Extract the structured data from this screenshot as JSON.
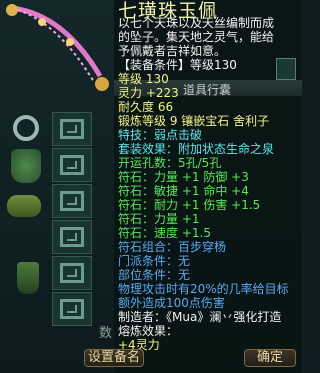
{
  "panel": {
    "title": "道具行囊"
  },
  "tooltip": {
    "name": "七璜珠玉佩",
    "desc_lines": [
      "以七个天珠以及天丝编制而成",
      "的坠子。集天地之灵气，能给",
      "予佩戴者吉祥如意。"
    ],
    "requirement": "【装备条件】等级130",
    "stats": [
      "等级 130",
      "灵力 +223",
      "耐久度 66"
    ],
    "forge": "锻炼等级 9   镶嵌宝石 舍利子",
    "special": "特技：弱点击破",
    "set_effect": "套装效果：附加状态生命之泉",
    "holes": "开运孔数：5孔/5孔",
    "runes": [
      "符石：力量 +1   防御 +3",
      "符石：敏捷 +1   命中 +4",
      "符石：耐力 +1   伤害 +1.5",
      "符石：力量 +1",
      "符石：速度 +1.5"
    ],
    "rune_combo": "符石组合：百步穿杨",
    "door": "门派条件：无",
    "position": "部位条件：无",
    "rune_desc": [
      "物理攻击时有20%的几率给目标",
      "额外造成100点伤害"
    ],
    "maker": "制造者：《Mua》澜丷强化打造",
    "enhance_label": "熔炼效果：",
    "enhance_value": "+4灵力"
  },
  "buttons": {
    "settings": "设置备名",
    "confirm": "确定",
    "under": "数"
  },
  "icons": [
    "jade-pendant-icon",
    "ring-icon",
    "armor-icon",
    "belt-icon",
    "boots-icon"
  ]
}
